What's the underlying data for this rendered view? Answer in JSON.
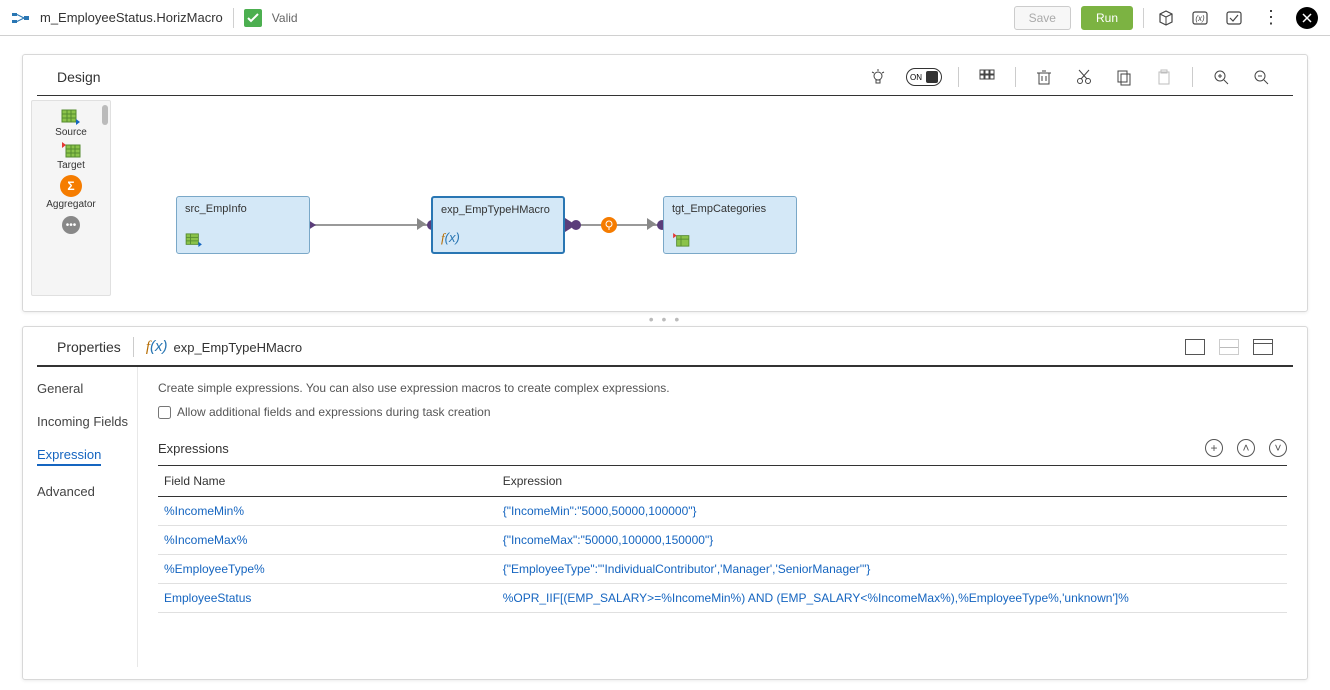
{
  "topbar": {
    "title": "m_EmployeeStatus.HorizMacro",
    "valid_label": "Valid",
    "save_label": "Save",
    "run_label": "Run"
  },
  "design": {
    "title": "Design",
    "toggle": "ON",
    "palette": {
      "source": "Source",
      "target": "Target",
      "aggregator": "Aggregator"
    },
    "nodes": {
      "src": "src_EmpInfo",
      "exp": "exp_EmpTypeHMacro",
      "tgt": "tgt_EmpCategories"
    }
  },
  "properties": {
    "title": "Properties",
    "object_name": "exp_EmpTypeHMacro",
    "tabs": {
      "general": "General",
      "incoming": "Incoming Fields",
      "expression": "Expression",
      "advanced": "Advanced"
    },
    "hint": "Create simple expressions. You can also use expression macros to create complex expressions.",
    "checkbox_label": "Allow additional fields and expressions during task creation",
    "section": "Expressions",
    "columns": {
      "field": "Field Name",
      "expr": "Expression"
    },
    "rows": [
      {
        "field": "%IncomeMin%",
        "expr": "{\"IncomeMin\":\"5000,50000,100000\"}"
      },
      {
        "field": "%IncomeMax%",
        "expr": "{\"IncomeMax\":\"50000,100000,150000\"}"
      },
      {
        "field": "%EmployeeType%",
        "expr": "{\"EmployeeType\":\"'IndividualContributor','Manager','SeniorManager'\"}"
      },
      {
        "field": "EmployeeStatus",
        "expr": "%OPR_IIF[(EMP_SALARY>=%IncomeMin%) AND (EMP_SALARY<%IncomeMax%),%EmployeeType%,'unknown']%"
      }
    ]
  }
}
